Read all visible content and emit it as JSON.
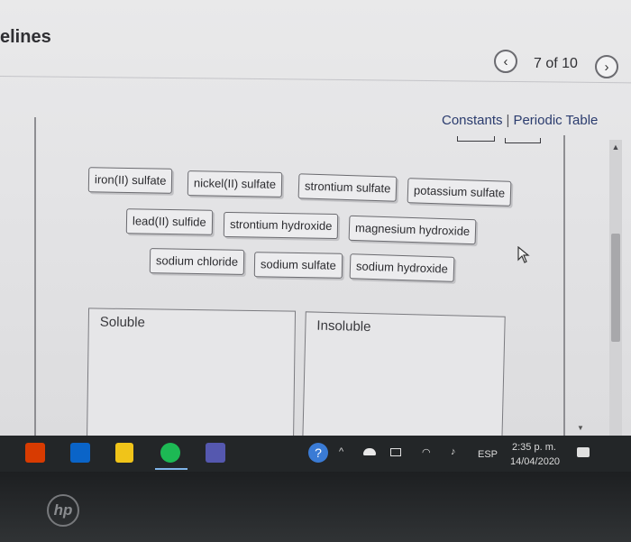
{
  "header": {
    "title": "elines",
    "prev_glyph": "‹",
    "next_glyph": "›",
    "page_counter": "7 of 10"
  },
  "links": {
    "constants": "Constants",
    "separator": "|",
    "periodic_table": "Periodic Table"
  },
  "chips": [
    "iron(II) sulfate",
    "nickel(II) sulfate",
    "strontium sulfate",
    "potassium sulfate",
    "lead(II) sulfide",
    "strontium hydroxide",
    "magnesium hydroxide",
    "sodium chloride",
    "sodium sulfate",
    "sodium hydroxide"
  ],
  "boxes": {
    "soluble": "Soluble",
    "insoluble": "Insoluble"
  },
  "taskbar": {
    "language": "ESP",
    "time": "2:35 p. m.",
    "date": "14/04/2020",
    "help_glyph": "?"
  },
  "bezel": {
    "logo_text": "hp"
  },
  "colors": {
    "link": "#2b3c6e",
    "chip_bg": "#ececee",
    "taskbar": "#232628",
    "spotify": "#1db954",
    "office": "#d83b01",
    "outlook": "#0a64c8"
  }
}
